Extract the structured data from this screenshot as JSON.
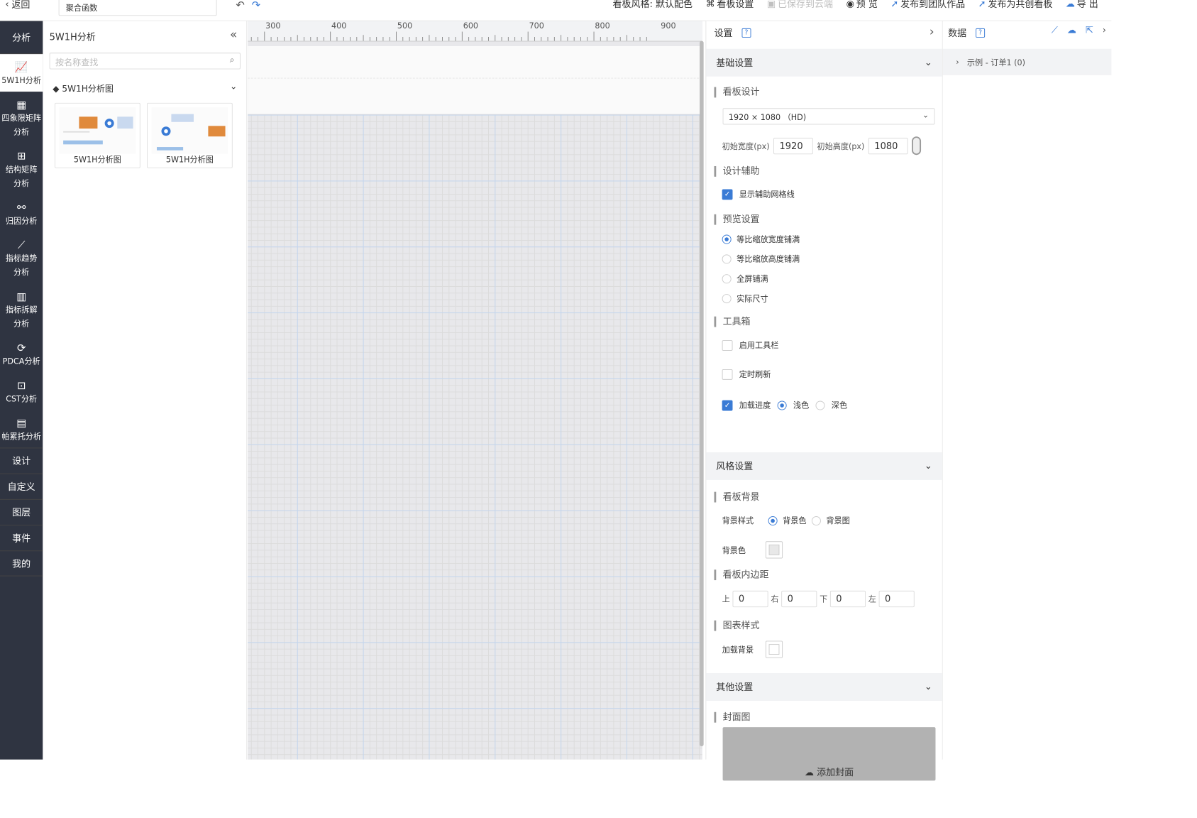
{
  "topbar": {
    "back": "返回",
    "func": "聚合函数",
    "style_label": "看板风格: 默认配色",
    "board_settings": "看板设置",
    "saved": "已保存到云端",
    "preview": "预 览",
    "publish_team": "发布到团队作品",
    "publish_shared": "发布为共创看板",
    "export": "导 出"
  },
  "nav": {
    "head": "分析",
    "items": [
      {
        "label": "5W1H分析"
      },
      {
        "label": "四象限矩阵分析"
      },
      {
        "label": "结构矩阵分析"
      },
      {
        "label": "归因分析"
      },
      {
        "label": "指标趋势分析"
      },
      {
        "label": "指标拆解分析"
      },
      {
        "label": "PDCA分析"
      },
      {
        "label": "CST分析"
      },
      {
        "label": "帕累托分析"
      }
    ],
    "tabs": [
      "设计",
      "自定义",
      "图层",
      "事件",
      "我的"
    ]
  },
  "library": {
    "title": "5W1H分析",
    "search_placeholder": "按名称查找",
    "group": "◆ 5W1H分析图",
    "thumbs": [
      "5W1H分析图",
      "5W1H分析图"
    ]
  },
  "ruler": {
    "labels": [
      "300",
      "400",
      "500",
      "600",
      "700",
      "800",
      "900"
    ]
  },
  "settings": {
    "title": "设置",
    "sec_basic": "基础设置",
    "board_design": "看板设计",
    "resolution": "1920 × 1080 （HD)",
    "init_w_label": "初始宽度(px)",
    "init_w": "1920",
    "init_h_label": "初始高度(px)",
    "init_h": "1080",
    "design_aid": "设计辅助",
    "show_grid": "显示辅助网格线",
    "preview_settings": "预览设置",
    "pv_opts": [
      "等比缩放宽度铺满",
      "等比缩放高度铺满",
      "全屏铺满",
      "实际尺寸"
    ],
    "toolbox": "工具箱",
    "enable_toolbar": "启用工具栏",
    "timed_refresh": "定时刷新",
    "load_progress": "加载进度",
    "light": "浅色",
    "dark": "深色",
    "sec_style": "风格设置",
    "board_bg": "看板背景",
    "bg_style": "背景样式",
    "bg_color_opt": "背景色",
    "bg_img_opt": "背景图",
    "bg_color": "背景色",
    "padding": "看板内边距",
    "pad_top": "上",
    "pad_right": "右",
    "pad_bottom": "下",
    "pad_left": "左",
    "pad_val": "0",
    "chart_style": "图表样式",
    "load_bg": "加载背景",
    "sec_other": "其他设置",
    "cover": "封面图",
    "add_cover": "添加封面"
  },
  "data": {
    "title": "数据",
    "dataset": "示例 - 订单1 (0)"
  },
  "colors": {
    "accent": "#3a7bd5",
    "nav_bg": "#2f3441"
  }
}
